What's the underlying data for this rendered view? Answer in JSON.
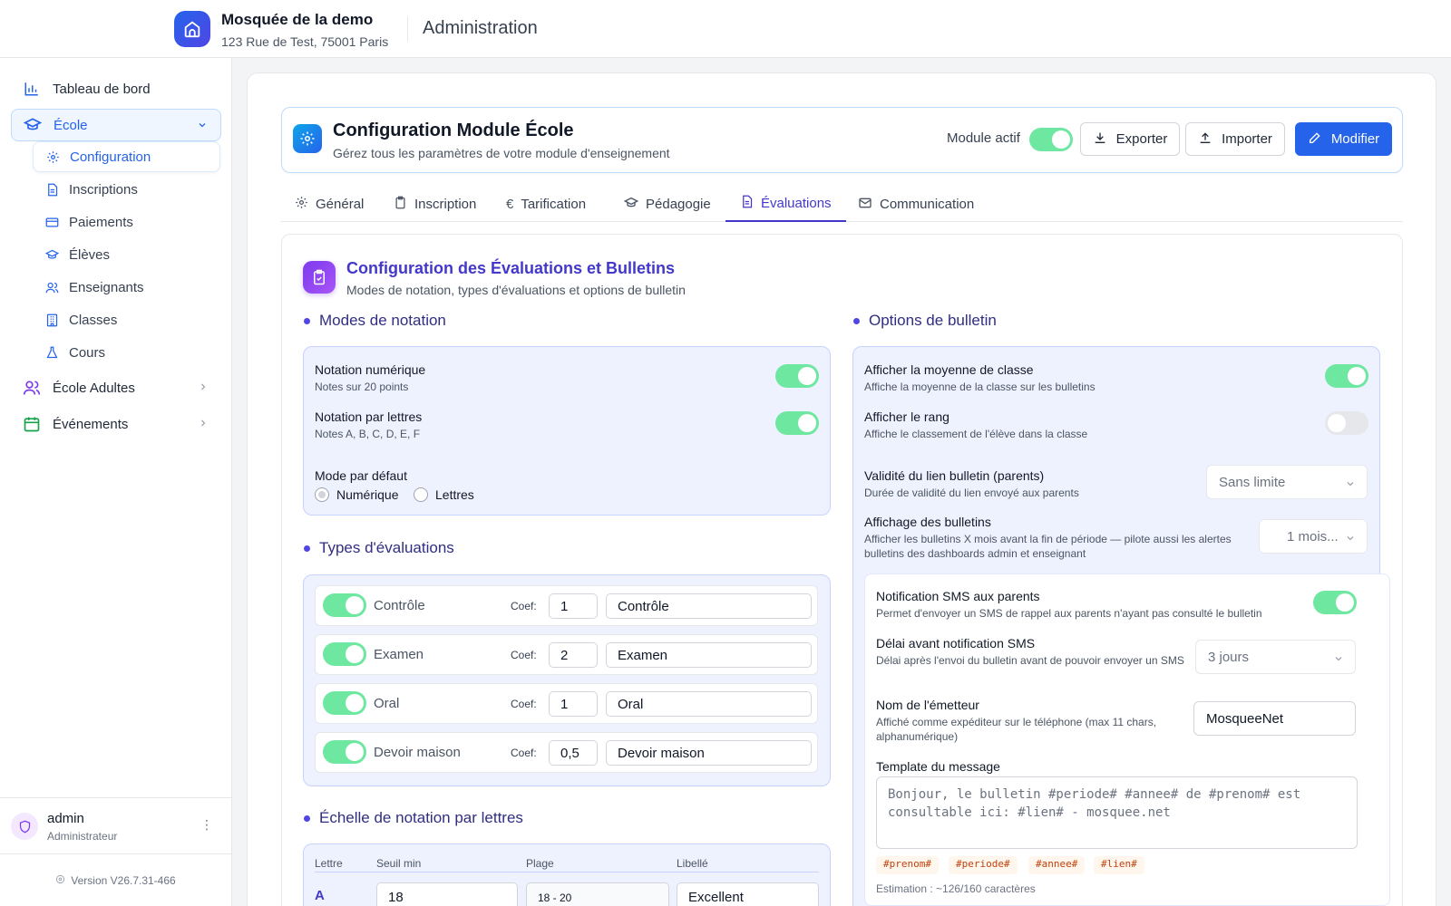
{
  "header": {
    "org_name": "Mosquée de la demo",
    "org_address": "123 Rue de Test, 75001 Paris",
    "section": "Administration"
  },
  "sidebar": {
    "items": [
      {
        "label": "Tableau de bord",
        "icon": "bar-chart-icon"
      },
      {
        "label": "École",
        "icon": "graduation-cap-icon",
        "expanded": true
      },
      {
        "label": "École Adultes",
        "icon": "users-icon"
      },
      {
        "label": "Événements",
        "icon": "calendar-icon"
      }
    ],
    "sub_items": [
      {
        "label": "Configuration",
        "icon": "gear-icon",
        "active": true
      },
      {
        "label": "Inscriptions",
        "icon": "document-icon"
      },
      {
        "label": "Paiements",
        "icon": "credit-card-icon"
      },
      {
        "label": "Élèves",
        "icon": "graduation-cap-icon"
      },
      {
        "label": "Enseignants",
        "icon": "users-icon"
      },
      {
        "label": "Classes",
        "icon": "building-icon"
      },
      {
        "label": "Cours",
        "icon": "flask-icon"
      }
    ],
    "user": {
      "name": "admin",
      "role": "Administrateur"
    },
    "version": "Version V26.7.31-466"
  },
  "config": {
    "title": "Configuration Module École",
    "subtitle": "Gérez tous les paramètres de votre module d'enseignement",
    "module_label": "Module actif",
    "module_active": true,
    "export_label": "Exporter",
    "import_label": "Importer",
    "edit_label": "Modifier"
  },
  "tabs": [
    {
      "label": "Général",
      "icon": "gear-icon"
    },
    {
      "label": "Inscription",
      "icon": "clipboard-icon"
    },
    {
      "label": "Tarification",
      "icon": "euro-icon"
    },
    {
      "label": "Pédagogie",
      "icon": "graduation-cap-icon"
    },
    {
      "label": "Évaluations",
      "icon": "document-icon",
      "active": true
    },
    {
      "label": "Communication",
      "icon": "mail-icon"
    }
  ],
  "panel": {
    "title": "Configuration des Évaluations et Bulletins",
    "subtitle": "Modes de notation, types d'évaluations et options de bulletin"
  },
  "notation": {
    "section_title": "Modes de notation",
    "numeric_label": "Notation numérique",
    "numeric_hint": "Notes sur 20 points",
    "numeric_on": true,
    "letters_label": "Notation par lettres",
    "letters_hint": "Notes A, B, C, D, E, F",
    "letters_on": true,
    "default_label": "Mode par défaut",
    "default_options": [
      "Numérique",
      "Lettres"
    ],
    "default_selected": "Numérique"
  },
  "eval_types": {
    "section_title": "Types d'évaluations",
    "coef_label": "Coef:",
    "rows": [
      {
        "name": "Contrôle",
        "coef": "1",
        "label": "Contrôle",
        "enabled": true
      },
      {
        "name": "Examen",
        "coef": "2",
        "label": "Examen",
        "enabled": true
      },
      {
        "name": "Oral",
        "coef": "1",
        "label": "Oral",
        "enabled": true
      },
      {
        "name": "Devoir maison",
        "coef": "0,5",
        "label": "Devoir maison",
        "enabled": true
      }
    ]
  },
  "letter_scale": {
    "section_title": "Échelle de notation par lettres",
    "columns": [
      "Lettre",
      "Seuil min",
      "Plage",
      "Libellé"
    ],
    "rows": [
      {
        "letter": "A",
        "min": "18",
        "range": "18 - 20",
        "label": "Excellent"
      }
    ]
  },
  "bulletin": {
    "section_title": "Options de bulletin",
    "class_avg_label": "Afficher la moyenne de classe",
    "class_avg_hint": "Affiche la moyenne de la classe sur les bulletins",
    "class_avg_on": true,
    "rank_label": "Afficher le rang",
    "rank_hint": "Affiche le classement de l'élève dans la classe",
    "rank_on": false,
    "validity_label": "Validité du lien bulletin (parents)",
    "validity_hint": "Durée de validité du lien envoyé aux parents",
    "validity_value": "Sans limite",
    "display_label": "Affichage des bulletins",
    "display_hint": "Afficher les bulletins X mois avant la fin de période — pilote aussi les alertes bulletins des dashboards admin et enseignant",
    "display_value": "1 mois..."
  },
  "sms": {
    "notif_label": "Notification SMS aux parents",
    "notif_hint": "Permet d'envoyer un SMS de rappel aux parents n'ayant pas consulté le bulletin",
    "notif_on": true,
    "delay_label": "Délai avant notification SMS",
    "delay_hint": "Délai après l'envoi du bulletin avant de pouvoir envoyer un SMS",
    "delay_value": "3 jours",
    "sender_label": "Nom de l'émetteur",
    "sender_hint": "Affiché comme expéditeur sur le téléphone (max 11 chars, alphanumérique)",
    "sender_value": "MosqueeNet",
    "template_label": "Template du message",
    "template_placeholder": "Bonjour, le bulletin #periode# #annee# de #prenom# est consultable ici: #lien# - mosquee.net",
    "variables": [
      "#prenom#",
      "#periode#",
      "#annee#",
      "#lien#"
    ],
    "estimate": "Estimation : ~126/160 caractères"
  },
  "colors": {
    "primary": "#2563eb",
    "accent_indigo": "#4338ca",
    "toggle_on": "#6ee7a1",
    "section_bg": "#eef2ff"
  }
}
